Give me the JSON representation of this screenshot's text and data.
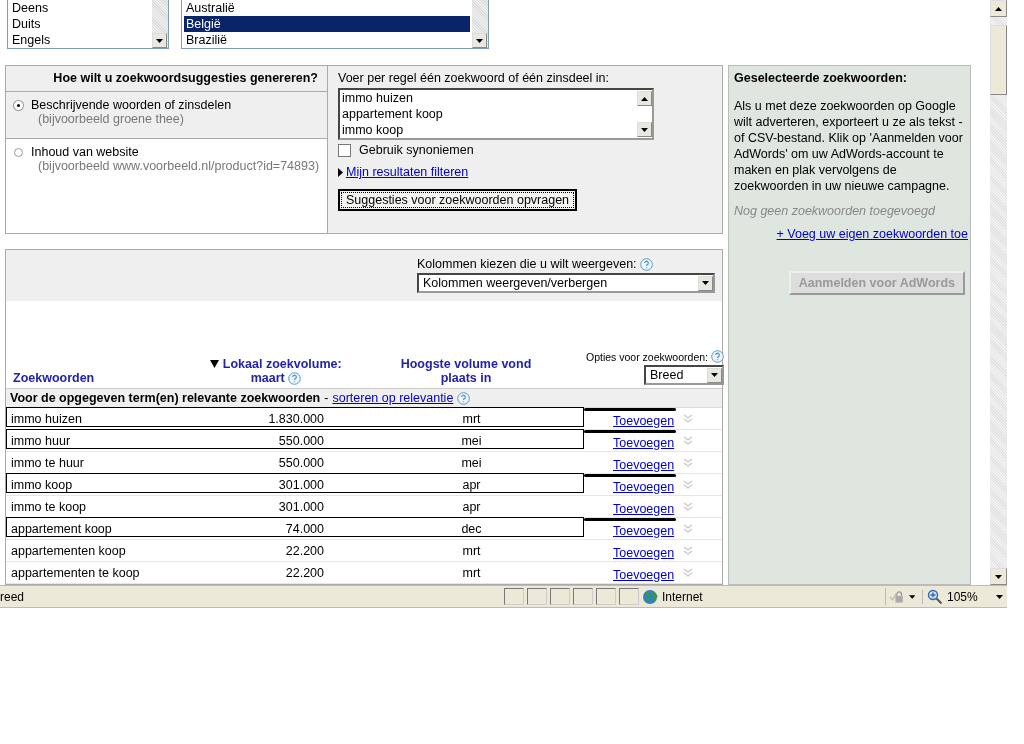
{
  "language_list": {
    "items": [
      {
        "label": "Deens",
        "selected": false
      },
      {
        "label": "Duits",
        "selected": false
      },
      {
        "label": "Engels",
        "selected": false
      }
    ]
  },
  "country_list": {
    "items": [
      {
        "label": "Australië",
        "selected": false
      },
      {
        "label": "België",
        "selected": true
      },
      {
        "label": "Brazilië",
        "selected": false
      }
    ]
  },
  "method_panel": {
    "title": "Hoe wilt u zoekwoordsuggesties genereren?",
    "options": [
      {
        "label": "Beschrijvende woorden of zinsdelen",
        "hint": "(bijvoorbeeld groene thee)",
        "selected": true
      },
      {
        "label": "Inhoud van website",
        "hint": "(bijvoorbeeld www.voorbeeld.nl/product?id=74893)",
        "selected": false
      }
    ]
  },
  "keyword_entry": {
    "label": "Voer per regel één zoekwoord of één zinsdeel in:",
    "lines": [
      "immo huizen",
      "appartement koop",
      "immo koop"
    ],
    "synonyms": {
      "label": "Gebruik synoniemen",
      "checked": false
    },
    "filter_link": "Mijn resultaten filteren",
    "submit": "Suggesties voor zoekwoorden opvragen"
  },
  "columns_picker": {
    "label": "Kolommen kiezen die u wilt weergeven:",
    "value": "Kolommen weergeven/verbergen"
  },
  "table": {
    "columns": [
      {
        "label": "Zoekwoorden",
        "sorted": false,
        "help": false
      },
      {
        "label": "Lokaal zoekvolume: maart",
        "sorted": true,
        "help": true
      },
      {
        "label": "Hoogste volume vond plaats in",
        "sorted": false,
        "help": false
      }
    ],
    "match_options": {
      "label": "Opties voor zoekwoorden:",
      "value": "Breed"
    },
    "group_title": "Voor de opgegeven term(en) relevante zoekwoorden",
    "group_separator": "-",
    "group_sort_link": "sorteren op relevantie",
    "rows": [
      {
        "keyword": "immo huizen",
        "volume": "1.830.000",
        "peak": "mrt",
        "action": "Toevoegen",
        "marked": true
      },
      {
        "keyword": "immo huur",
        "volume": "550.000",
        "peak": "mei",
        "action": "Toevoegen",
        "marked": true
      },
      {
        "keyword": "immo te huur",
        "volume": "550.000",
        "peak": "mei",
        "action": "Toevoegen",
        "marked": false
      },
      {
        "keyword": "immo koop",
        "volume": "301.000",
        "peak": "apr",
        "action": "Toevoegen",
        "marked": true
      },
      {
        "keyword": "immo te koop",
        "volume": "301.000",
        "peak": "apr",
        "action": "Toevoegen",
        "marked": false
      },
      {
        "keyword": "appartement koop",
        "volume": "74.000",
        "peak": "dec",
        "action": "Toevoegen",
        "marked": true
      },
      {
        "keyword": "appartementen koop",
        "volume": "22.200",
        "peak": "mrt",
        "action": "Toevoegen",
        "marked": false
      },
      {
        "keyword": "appartementen te koop",
        "volume": "22.200",
        "peak": "mrt",
        "action": "Toevoegen",
        "marked": false
      }
    ]
  },
  "selected_panel": {
    "title": "Geselecteerde zoekwoorden:",
    "description": "Als u met deze zoekwoorden op Google wilt adverteren, exporteert u ze als tekst - of CSV-bestand. Klik op 'Aanmelden voor AdWords' om uw AdWords-account te maken en plak vervolgens de zoekwoorden in uw nieuwe campagne.",
    "empty_note": "Nog geen zoekwoorden toegevoegd",
    "add_link": "+ Voeg uw eigen zoekwoorden toe",
    "signup_button": {
      "label": "Aanmelden voor AdWords",
      "disabled": true
    }
  },
  "status_bar": {
    "text": "reed",
    "zone": "Internet",
    "zoom": "105%"
  }
}
